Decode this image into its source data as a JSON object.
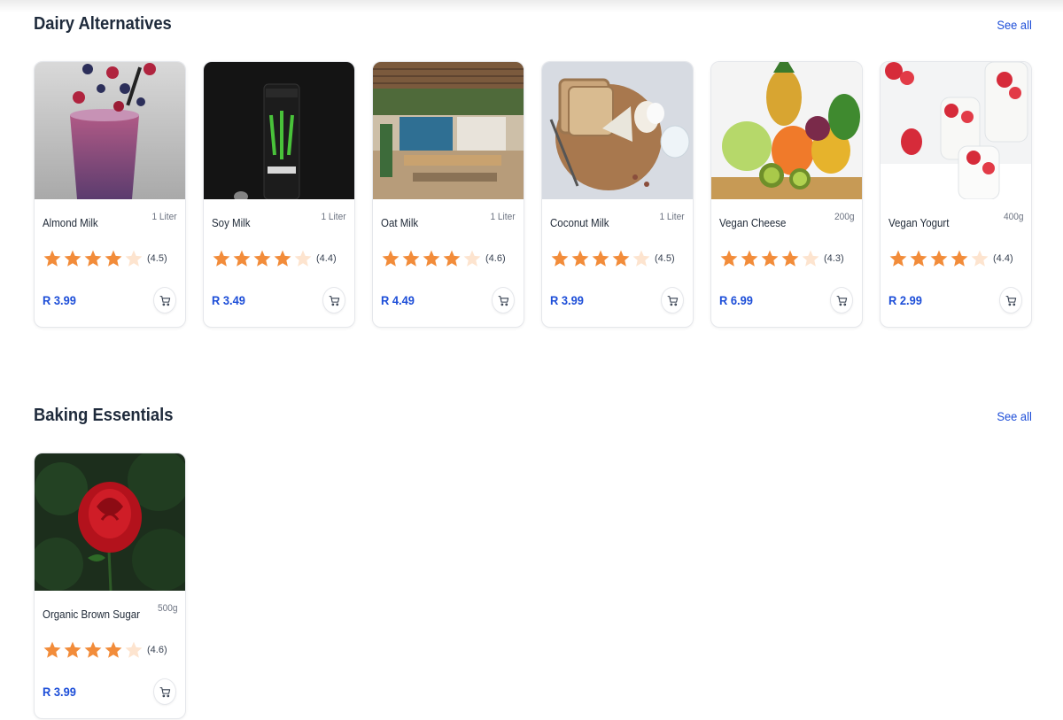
{
  "colors": {
    "accent": "#1d4ed8",
    "star_filled": "#f28c3a",
    "star_empty": "#fde4cf",
    "title": "#1e2a3b"
  },
  "sections": [
    {
      "title": "Dairy Alternatives",
      "see_all": "See all",
      "products": [
        {
          "name": "Almond Milk",
          "size": "1 Liter",
          "rating": 4.5,
          "rating_label": "(4.5)",
          "stars_filled": 4,
          "price": "R 3.99",
          "image": "smoothie-berries"
        },
        {
          "name": "Soy Milk",
          "size": "1 Liter",
          "rating": 4.4,
          "rating_label": "(4.4)",
          "stars_filled": 4,
          "price": "R 3.49",
          "image": "energy-drink-can"
        },
        {
          "name": "Oat Milk",
          "size": "1 Liter",
          "rating": 4.6,
          "rating_label": "(4.6)",
          "stars_filled": 4,
          "price": "R 4.49",
          "image": "cafe-interior"
        },
        {
          "name": "Coconut Milk",
          "size": "1 Liter",
          "rating": 4.5,
          "rating_label": "(4.5)",
          "stars_filled": 4,
          "price": "R 3.99",
          "image": "bread-cheese-eggs"
        },
        {
          "name": "Vegan Cheese",
          "size": "200g",
          "rating": 4.3,
          "rating_label": "(4.3)",
          "stars_filled": 4,
          "price": "R 6.99",
          "image": "fruit-basket"
        },
        {
          "name": "Vegan Yogurt",
          "size": "400g",
          "rating": 4.4,
          "rating_label": "(4.4)",
          "stars_filled": 4,
          "price": "R 2.99",
          "image": "yogurt-strawberries"
        }
      ]
    },
    {
      "title": "Baking Essentials",
      "see_all": "See all",
      "products": [
        {
          "name": "Organic Brown Sugar",
          "size": "500g",
          "rating": 4.6,
          "rating_label": "(4.6)",
          "stars_filled": 4,
          "price": "R 3.99",
          "image": "red-rose"
        }
      ]
    }
  ]
}
